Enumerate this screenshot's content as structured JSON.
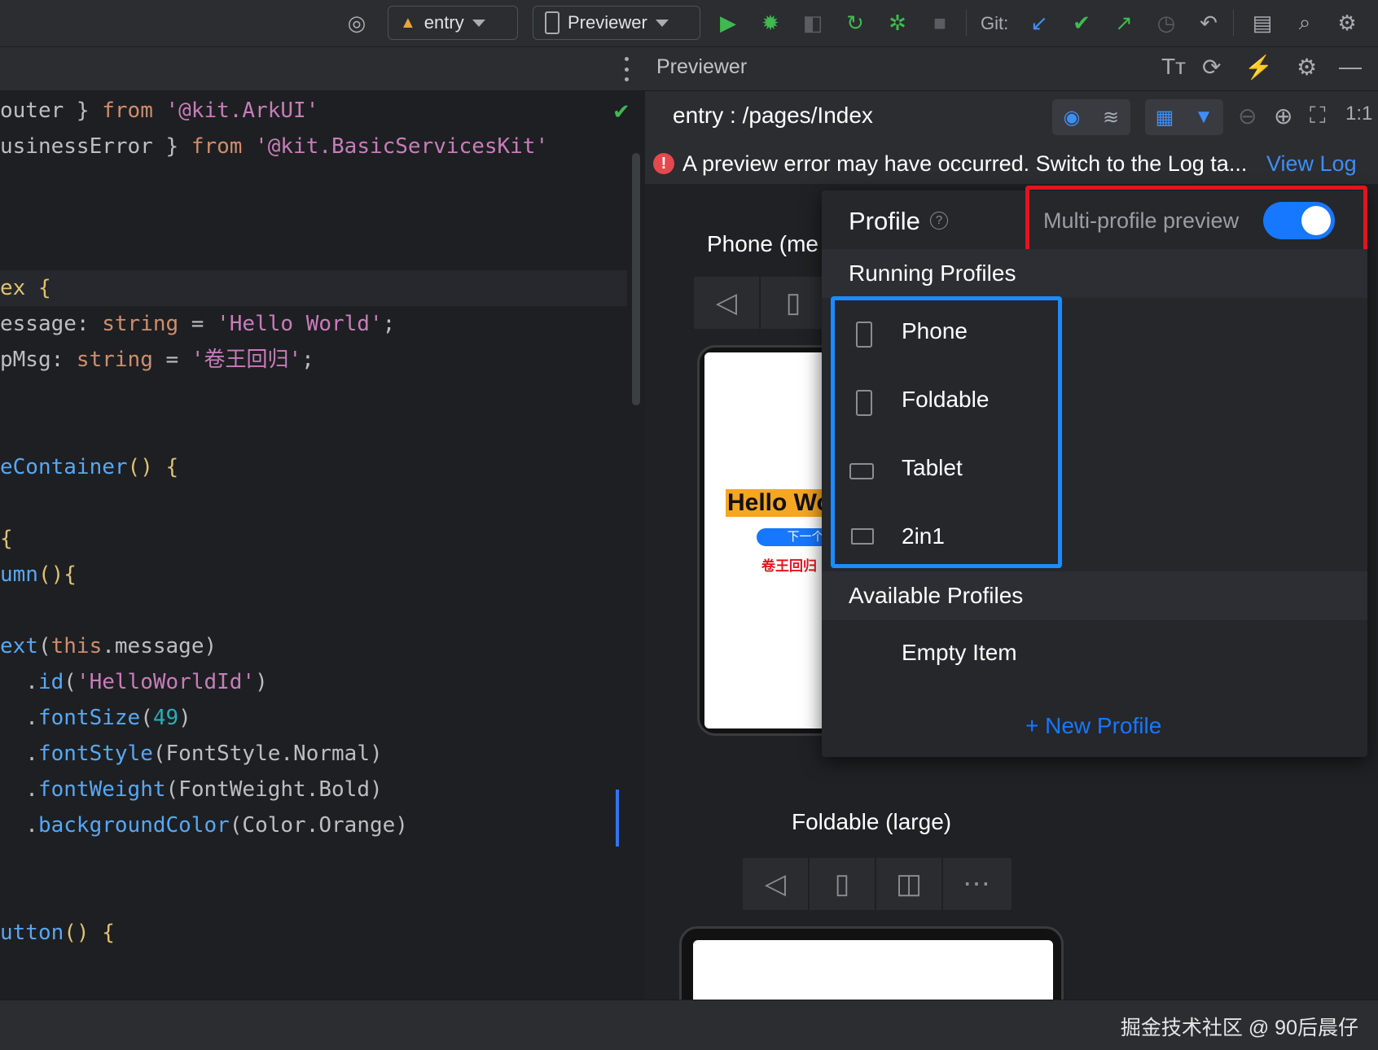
{
  "toolbar": {
    "module_combo": "entry",
    "device_combo": "Previewer",
    "git_label": "Git:"
  },
  "editor": {
    "line1_a": "outer } ",
    "line1_kw": "from",
    "line1_str": " '@kit.ArkUI'",
    "line2_a": "usinessError } ",
    "line2_kw": "from",
    "line2_str": " '@kit.BasicServicesKit'",
    "line3": "ex {",
    "line4_a": "essage: ",
    "line4_ty": "string",
    "line4_b": " = ",
    "line4_str": "'Hello World'",
    "line4_c": ";",
    "line5_a": "pMsg: ",
    "line5_ty": "string",
    "line5_b": " = ",
    "line5_str": "'卷王回归'",
    "line5_c": ";",
    "line6": "{",
    "line7_fn": "eContainer",
    "line7_b": "() {",
    "line8": "{",
    "line9_fn": "umn",
    "line9_b": "(){",
    "line10_fn": "ext",
    "line10_b": "(",
    "line10_kw": "this",
    "line10_c": ".message)",
    "line11_a": "  .",
    "line11_fn": "id",
    "line11_b": "(",
    "line11_str": "'HelloWorldId'",
    "line11_c": ")",
    "line12_a": "  .",
    "line12_fn": "fontSize",
    "line12_b": "(",
    "line12_num": "49",
    "line12_c": ")",
    "line13_a": "  .",
    "line13_fn": "fontStyle",
    "line13_b": "(FontStyle.Normal)",
    "line14_a": "  .",
    "line14_fn": "fontWeight",
    "line14_b": "(FontWeight.Bold)",
    "line15_a": "  .",
    "line15_fn": "backgroundColor",
    "line15_b": "(Color.Orange)",
    "line16_fn": "utton",
    "line16_b": "() {"
  },
  "previewer": {
    "title": "Previewer",
    "route": "entry : /pages/Index",
    "error_text": "A preview error may have occurred. Switch to the Log ta...",
    "error_link": "View Log",
    "device1_label": "Phone (me",
    "device2_label": "Foldable (large)",
    "phone_preview": {
      "hello_text": "Hello Wo",
      "next_button": "下一个",
      "red_text": "卷王回归"
    }
  },
  "profile_popup": {
    "title": "Profile",
    "multi_profile_label": "Multi-profile preview",
    "multi_profile_enabled": true,
    "running_header": "Running Profiles",
    "running_profiles": [
      {
        "label": "Phone",
        "icon": "phone-icon"
      },
      {
        "label": "Foldable",
        "icon": "phone-icon"
      },
      {
        "label": "Tablet",
        "icon": "tablet-icon"
      },
      {
        "label": "2in1",
        "icon": "monitor-icon"
      }
    ],
    "available_header": "Available Profiles",
    "available_profiles": [
      {
        "label": "Empty Item"
      }
    ],
    "new_profile": "+ New Profile"
  },
  "colors": {
    "highlight_red": "#e5141c",
    "highlight_blue": "#1a8cff",
    "accent_blue": "#1677ff"
  },
  "watermark": "掘金技术社区 @ 90后晨仔"
}
